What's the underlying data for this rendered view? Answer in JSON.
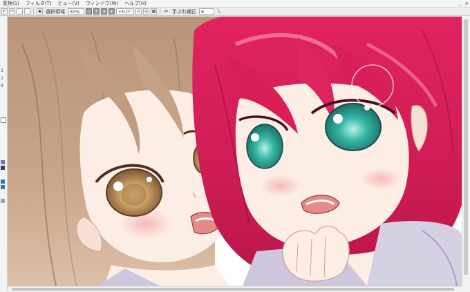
{
  "menubar": {
    "items": [
      "変換(S)",
      "フィルタ(T)",
      "ビュー(V)",
      "ウィンドウ(W)",
      "ヘルプ(H)"
    ],
    "window_buttons": [
      "_",
      "×"
    ]
  },
  "toolbar": {
    "selection_area_label": "選択領域",
    "zoom_value": "50%",
    "rotation_value": "+0.0°",
    "stabilizer_label": "手ぶれ補正",
    "stabilizer_value": "6",
    "icons": [
      "undo-icon",
      "redo-icon",
      "eye-icon",
      "zoom-out-icon",
      "zoom-in-icon",
      "rotate-left-icon",
      "rotate-right-icon",
      "reset-view-icon",
      "flip-icon",
      "invert-icon",
      "stabilizer-icon",
      "pen-icon"
    ]
  },
  "ruler": {
    "numbers": [
      "3",
      "7",
      "9"
    ]
  },
  "colors": {
    "accent": "#3b6fd6",
    "canvas_bg": "#ffffff"
  }
}
